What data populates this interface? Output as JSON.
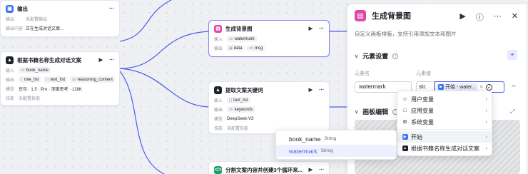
{
  "nodes": {
    "output": {
      "title": "输出",
      "rows": [
        {
          "key": "输出",
          "value": "未配置输出"
        },
        {
          "key": "输出内容",
          "value": "正在生成对话文案..."
        }
      ]
    },
    "llm": {
      "title": "根据书籍名称生成对话文案",
      "input_key": "输入",
      "input_tag": "book_name",
      "output_key": "输出",
      "output_tags": [
        "role_list",
        "text_list",
        "reasoning_content"
      ],
      "output_type_prefix": "1",
      "model_key": "模型",
      "model_value": "豆包 · 1.5 · Pro · 深度思考 · 128K",
      "skill_key": "技能",
      "skill_value": "未配置技能"
    },
    "bg": {
      "title": "生成背景图",
      "input_key": "输入",
      "input_tag": "watermark",
      "output_key": "输出",
      "output_tags": [
        "data",
        "msg"
      ]
    },
    "kw": {
      "title": "提取文案关键词",
      "input_key": "输入",
      "input_tag": "text_list",
      "output_key": "输出",
      "output_tag": "keywords",
      "model_key": "模型",
      "model_value": "DeepSeek-V3",
      "skill_key": "技能",
      "skill_value": "未配置技能"
    },
    "loop": {
      "title": "分割文案内容并创建3个循环来..."
    }
  },
  "panel": {
    "title": "生成背景图",
    "description": "自定义画板排版，支持引用添加文本和图片",
    "section_elements": "元素设置",
    "col_name": "元素名",
    "col_value": "元素值",
    "row_name": "watermark",
    "row_type": "str.",
    "row_value_label": "开始 - water...",
    "section_canvas": "画板编辑"
  },
  "var_menu": {
    "items": [
      {
        "icon": "user-icon",
        "label": "用户变量"
      },
      {
        "icon": "app-icon",
        "label": "应用变量"
      },
      {
        "icon": "system-icon",
        "label": "系统变量"
      },
      {
        "icon": "start-icon",
        "label": "开始"
      },
      {
        "icon": "llm-icon",
        "label": "根据书籍名称生成对话文案"
      }
    ]
  },
  "sub_menu": {
    "items": [
      {
        "name": "book_name",
        "type": "String"
      },
      {
        "name": "watermark",
        "type": "String"
      }
    ]
  },
  "colors": {
    "accent": "#4e5bf2",
    "wire": "#3f56e6",
    "image_node": "#e045a6",
    "start_node": "#3f73f5"
  }
}
